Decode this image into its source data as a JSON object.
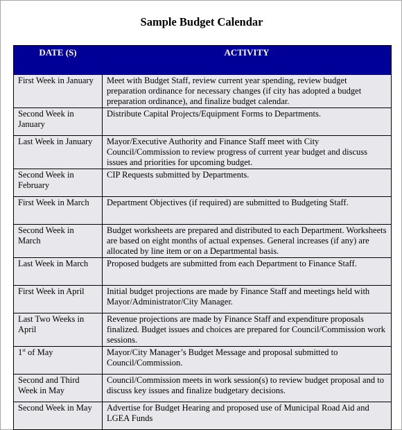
{
  "document": {
    "title": "Sample Budget Calendar"
  },
  "table": {
    "headers": {
      "date": "DATE (S)",
      "activity": "ACTIVITY"
    },
    "header_color": "#000099",
    "row_color": "#e8e8ec",
    "rows": [
      {
        "date": "First Week in January",
        "activity": "Meet with Budget Staff, review current year spending, review budget preparation ordinance for necessary changes (if city has adopted a budget preparation ordinance), and finalize budget calendar."
      },
      {
        "date": "Second Week in January",
        "activity": "Distribute Capital Projects/Equipment Forms to Departments."
      },
      {
        "date": "Last Week in January",
        "activity": "Mayor/Executive Authority and Finance Staff meet with City Council/Commission to review progress of current year budget and discuss issues and priorities for upcoming budget."
      },
      {
        "date": "Second Week in February",
        "activity": "CIP Requests submitted by Departments."
      },
      {
        "date": "First Week in March",
        "activity": "Department Objectives (if required) are submitted to Budgeting Staff."
      },
      {
        "date": "Second Week in March",
        "activity": "Budget worksheets are prepared and distributed to each Department. Worksheets are based on eight months of actual expenses.  General increases (if any) are allocated by line item or on a Departmental basis."
      },
      {
        "date": "Last Week in March",
        "activity": "Proposed budgets are submitted from each Department to Finance Staff."
      },
      {
        "date": "First Week in April",
        "activity": "Initial budget projections are made by Finance Staff and meetings held with Mayor/Administrator/City Manager."
      },
      {
        "date": "Last Two Weeks in April",
        "activity": "Revenue projections are made by Finance Staff and expenditure proposals finalized.  Budget issues and choices are prepared for Council/Commission work sessions."
      },
      {
        "date_number": "1",
        "date_suffix": "st",
        "date_rest": " of May",
        "activity": "Mayor/City Manager’s Budget Message and proposal submitted to Council/Commission."
      },
      {
        "date": "Second and Third Week in May",
        "activity": "Council/Commission meets in work session(s) to review budget proposal and to discuss key issues and finalize budgetary decisions."
      },
      {
        "date": "Second Week in May",
        "activity": "Advertise for Budget Hearing and proposed use of Municipal Road Aid and LGEA Funds"
      }
    ]
  }
}
